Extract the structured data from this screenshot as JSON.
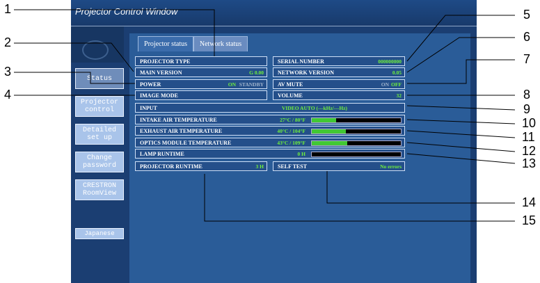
{
  "window": {
    "title": "Projector Control Window"
  },
  "tabs": [
    {
      "label": "Projector status"
    },
    {
      "label": "Network status"
    }
  ],
  "nav": {
    "items": [
      {
        "label": "Status"
      },
      {
        "label": "Projector control"
      },
      {
        "label": "Detailed set up"
      },
      {
        "label": "Change password"
      },
      {
        "label": "CRESTRON RoomView"
      }
    ],
    "language": "Japanese"
  },
  "status": {
    "projector_type": {
      "label": "PROJECTOR TYPE",
      "value": ""
    },
    "main_version": {
      "label": "MAIN VERSION",
      "value": "G 0.00"
    },
    "power": {
      "label": "POWER",
      "on": "ON",
      "standby": "STANDBY"
    },
    "image_mode": {
      "label": "IMAGE MODE",
      "value": ""
    },
    "serial_number": {
      "label": "SERIAL NUMBER",
      "value": "000000000"
    },
    "network_version": {
      "label": "NETWORK VERSION",
      "value": "0.05"
    },
    "av_mute": {
      "label": "AV MUTE",
      "on": "ON",
      "off": "OFF"
    },
    "volume": {
      "label": "VOLUME",
      "value": "32"
    },
    "input": {
      "label": "INPUT",
      "value": "VIDEO   AUTO (---kHz/---Hz)"
    },
    "intake_temp": {
      "label": "INTAKE AIR TEMPERATURE",
      "value": "27°C / 80°F",
      "level": 0.27
    },
    "exhaust_temp": {
      "label": "EXHAUST AIR TEMPERATURE",
      "value": "40°C / 104°F",
      "level": 0.38
    },
    "optics_temp": {
      "label": "OPTICS MODULE TEMPERATURE",
      "value": "43°C / 109°F",
      "level": 0.4
    },
    "lamp_runtime": {
      "label": "LAMP RUNTIME",
      "value": "0 H",
      "level": 0
    },
    "projector_runtime": {
      "label": "PROJECTOR RUNTIME",
      "value": "3 H"
    },
    "self_test": {
      "label": "SELF TEST",
      "value": "No errors"
    }
  },
  "callouts": [
    "1",
    "2",
    "3",
    "4",
    "5",
    "6",
    "7",
    "8",
    "9",
    "10",
    "11",
    "12",
    "13",
    "14",
    "15"
  ]
}
